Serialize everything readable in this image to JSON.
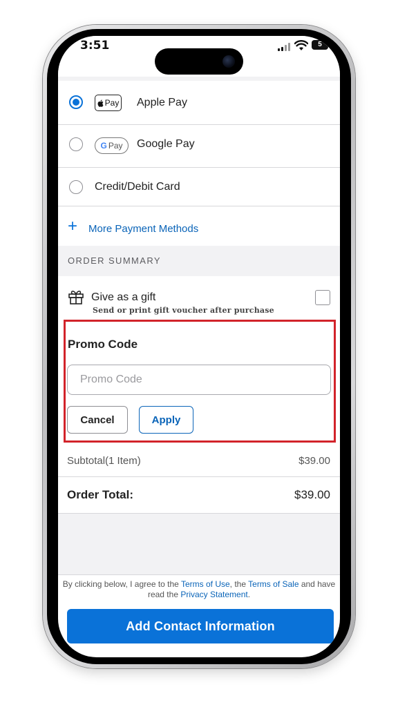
{
  "status_bar": {
    "time": "3:51",
    "battery": "5",
    "icons": [
      "cellular-signal-icon",
      "wifi-icon",
      "battery-icon"
    ]
  },
  "payment_methods": [
    {
      "badge": "Pay",
      "badge_icon": "apple-logo-icon",
      "label": "Apple Pay",
      "selected": true
    },
    {
      "badge": "Pay",
      "badge_icon": "google-g-logo-icon",
      "label": "Google Pay",
      "selected": false
    },
    {
      "label": "Credit/Debit Card",
      "selected": false
    }
  ],
  "more_methods": {
    "icon": "plus-icon",
    "label": "More Payment Methods"
  },
  "order_summary": {
    "heading": "ORDER SUMMARY",
    "gift": {
      "icon": "gift-icon",
      "label": "Give as a gift",
      "sublabel": "Send or print gift voucher after purchase",
      "checked": false
    },
    "promo": {
      "title": "Promo Code",
      "placeholder": "Promo Code",
      "value": "",
      "cancel_label": "Cancel",
      "apply_label": "Apply"
    },
    "subtotal": {
      "label": "Subtotal(1 Item)",
      "value": "$39.00"
    },
    "total": {
      "label": "Order Total:",
      "value": "$39.00"
    }
  },
  "legal": {
    "prefix": "By clicking below, I agree to the ",
    "terms_of_use": "Terms of Use",
    "middle": ", the ",
    "terms_of_sale": "Terms of Sale",
    "and": " and have read the ",
    "privacy": "Privacy Statement",
    "suffix": "."
  },
  "cta": {
    "label": "Add Contact Information"
  },
  "colors": {
    "accent": "#0a72d8",
    "link": "#0a64b8",
    "highlight_border": "#d2232a",
    "section_bg": "#f2f2f4"
  }
}
